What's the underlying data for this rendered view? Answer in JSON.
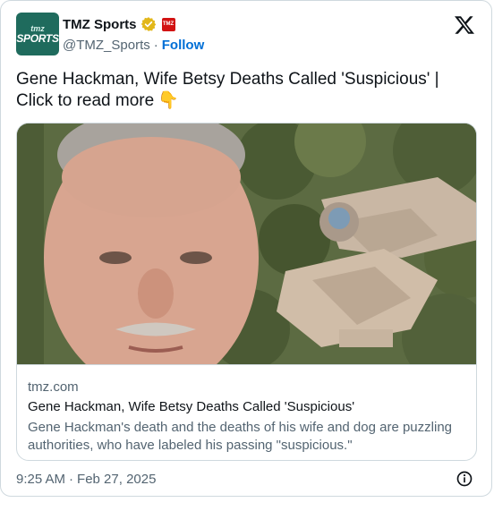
{
  "author": {
    "avatar_text_top": "tmz",
    "avatar_text_main": "SPORTS",
    "display_name": "TMZ Sports",
    "handle": "@TMZ_Sports",
    "separator": "·",
    "follow_label": "Follow",
    "affiliate_badge_text": "TMZ"
  },
  "tweet": {
    "text": "Gene Hackman, Wife Betsy Deaths Called 'Suspicious'  |  Click to read more",
    "emoji": "👇"
  },
  "link_card": {
    "domain": "tmz.com",
    "title": "Gene Hackman, Wife Betsy Deaths Called 'Suspicious'",
    "description": "Gene Hackman's death and the deaths of his wife and dog are puzzling authorities, who have labeled his passing \"suspicious.\""
  },
  "footer": {
    "time": "9:25 AM",
    "separator": "·",
    "date": "Feb 27, 2025"
  },
  "colors": {
    "accent": "#006fd6",
    "verified": "#e2b719",
    "secondary_text": "#536471",
    "border": "#cfd9de"
  },
  "icons": [
    "verified-badge-icon",
    "affiliate-badge-icon",
    "x-logo-icon",
    "info-icon"
  ]
}
